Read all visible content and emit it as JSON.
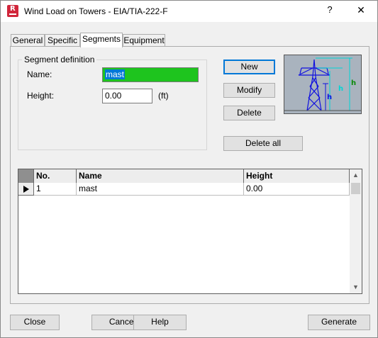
{
  "window": {
    "title": "Wind Load on Towers - EIA/TIA-222-F",
    "help_glyph": "?",
    "close_glyph": "✕",
    "app_icon_letter": "R"
  },
  "tabs": [
    {
      "label": "General",
      "active": false
    },
    {
      "label": "Specific",
      "active": false
    },
    {
      "label": "Segments",
      "active": true
    },
    {
      "label": "Equipment",
      "active": false
    }
  ],
  "segment_definition": {
    "legend": "Segment definition",
    "name_label": "Name:",
    "name_value": "mast",
    "height_label": "Height:",
    "height_value": "0.00",
    "height_unit": "(ft)"
  },
  "actions": {
    "new": "New",
    "modify": "Modify",
    "delete": "Delete",
    "delete_all": "Delete all"
  },
  "preview": {
    "label_h": "h"
  },
  "grid": {
    "columns": [
      "No.",
      "Name",
      "Height"
    ],
    "rows": [
      {
        "no": "1",
        "name": "mast",
        "height": "0.00"
      }
    ]
  },
  "footer": {
    "close": "Close",
    "cancel": "Cancel",
    "help": "Help",
    "generate": "Generate"
  },
  "colors": {
    "name_field_bg": "#1ec41e",
    "selection": "#0078d7",
    "preview_bg": "#a9b3be",
    "tower_blue": "#1010e0",
    "tower_cyan": "#00d5d5"
  }
}
